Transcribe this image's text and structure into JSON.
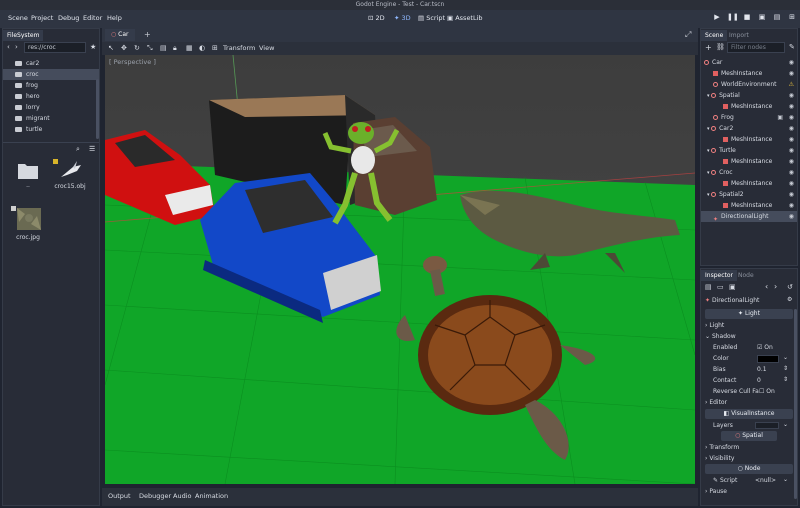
{
  "window_title": "Godot Engine - Test - Car.tscn",
  "menu": [
    "Scene",
    "Project",
    "Debug",
    "Editor",
    "Help"
  ],
  "workspaces": {
    "w2d": "2D",
    "w3d": "3D",
    "script": "Script",
    "assetlib": "AssetLib"
  },
  "filesystem": {
    "tab": "FileSystem",
    "path": "res://croc",
    "folders": [
      "car2",
      "croc",
      "frog",
      "hero",
      "lorry",
      "migrant",
      "turtle"
    ],
    "selected_folder": "croc",
    "files": [
      {
        "name": "..",
        "type": "folder"
      },
      {
        "name": "croc15.obj",
        "type": "mesh"
      },
      {
        "name": "croc.jpg",
        "type": "image"
      }
    ]
  },
  "editor": {
    "scene_tab": "Car",
    "toolbar": {
      "transform": "Transform",
      "view": "View"
    },
    "viewport_label": "[ Perspective ]"
  },
  "bottom_tabs": [
    "Output",
    "Debugger",
    "Audio",
    "Animation"
  ],
  "scene": {
    "tabs": {
      "scene": "Scene",
      "import": "Import"
    },
    "filter_placeholder": "Filter nodes",
    "nodes": [
      {
        "name": "Car",
        "depth": 0,
        "kind": "spatial"
      },
      {
        "name": "MeshInstance",
        "depth": 1,
        "kind": "mesh"
      },
      {
        "name": "WorldEnvironment",
        "depth": 1,
        "kind": "env",
        "warning": true
      },
      {
        "name": "Spatial",
        "depth": 1,
        "kind": "spatial"
      },
      {
        "name": "MeshInstance",
        "depth": 2,
        "kind": "mesh"
      },
      {
        "name": "Frog",
        "depth": 1,
        "kind": "spatial"
      },
      {
        "name": "Car2",
        "depth": 1,
        "kind": "spatial"
      },
      {
        "name": "MeshInstance",
        "depth": 2,
        "kind": "mesh"
      },
      {
        "name": "Turtle",
        "depth": 1,
        "kind": "spatial"
      },
      {
        "name": "MeshInstance",
        "depth": 2,
        "kind": "mesh"
      },
      {
        "name": "Croc",
        "depth": 1,
        "kind": "spatial"
      },
      {
        "name": "MeshInstance",
        "depth": 2,
        "kind": "mesh"
      },
      {
        "name": "Spatial2",
        "depth": 1,
        "kind": "spatial"
      },
      {
        "name": "MeshInstance",
        "depth": 2,
        "kind": "mesh"
      },
      {
        "name": "DirectionalLight",
        "depth": 1,
        "kind": "light",
        "selected": true
      }
    ]
  },
  "inspector": {
    "tabs": {
      "inspector": "Inspector",
      "node": "Node"
    },
    "object": "DirectionalLight",
    "class_light": "Light",
    "section_light": "Light",
    "section_shadow": "Shadow",
    "props": {
      "enabled_label": "Enabled",
      "enabled_value": "On",
      "color_label": "Color",
      "bias_label": "Bias",
      "bias_value": "0.1",
      "contact_label": "Contact",
      "contact_value": "0",
      "reverse_label": "Reverse Cull Fa",
      "reverse_value": "On"
    },
    "section_editor": "Editor",
    "class_visual": "VisualInstance",
    "layers_label": "Layers",
    "class_spatial": "Spatial",
    "section_transform": "Transform",
    "section_visibility": "Visibility",
    "class_node": "Node",
    "script_label": "Script",
    "script_value": "<null>",
    "section_pause": "Pause"
  },
  "colors": {
    "accent": "#8fb8ff",
    "panel": "#282c37",
    "ground": "#10a628",
    "shadow_color": "#000000"
  }
}
